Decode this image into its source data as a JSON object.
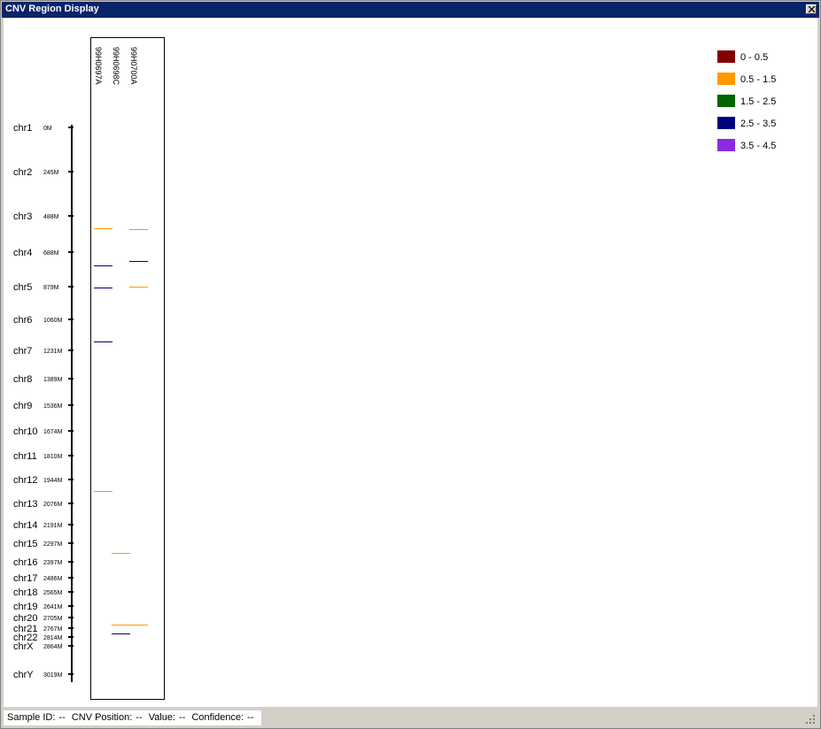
{
  "window": {
    "title": "CNV Region Display"
  },
  "samples": [
    "99H0697A",
    "99H0698C",
    "99H0700A"
  ],
  "chromosomes": [
    {
      "name": "chr1",
      "pos": "0M"
    },
    {
      "name": "chr2",
      "pos": "245M"
    },
    {
      "name": "chr3",
      "pos": "488M"
    },
    {
      "name": "chr4",
      "pos": "688M"
    },
    {
      "name": "chr5",
      "pos": "879M"
    },
    {
      "name": "chr6",
      "pos": "1060M"
    },
    {
      "name": "chr7",
      "pos": "1231M"
    },
    {
      "name": "chr8",
      "pos": "1389M"
    },
    {
      "name": "chr9",
      "pos": "1536M"
    },
    {
      "name": "chr10",
      "pos": "1674M"
    },
    {
      "name": "chr11",
      "pos": "1810M"
    },
    {
      "name": "chr12",
      "pos": "1944M"
    },
    {
      "name": "chr13",
      "pos": "2076M"
    },
    {
      "name": "chr14",
      "pos": "2191M"
    },
    {
      "name": "chr15",
      "pos": "2297M"
    },
    {
      "name": "chr16",
      "pos": "2397M"
    },
    {
      "name": "chr17",
      "pos": "2486M"
    },
    {
      "name": "chr18",
      "pos": "2565M"
    },
    {
      "name": "chr19",
      "pos": "2641M"
    },
    {
      "name": "chr20",
      "pos": "2705M"
    },
    {
      "name": "chr21",
      "pos": "2767M"
    },
    {
      "name": "chr22",
      "pos": "2814M"
    },
    {
      "name": "chrX",
      "pos": "2864M"
    },
    {
      "name": "chrY",
      "pos": "3019M"
    }
  ],
  "legend": [
    {
      "label": "0 - 0.5",
      "color": "#800000"
    },
    {
      "label": "0.5 - 1.5",
      "color": "#ff9900"
    },
    {
      "label": "1.5 - 2.5",
      "color": "#006400"
    },
    {
      "label": "2.5 - 3.5",
      "color": "#000080"
    },
    {
      "label": "3.5 - 4.5",
      "color": "#8a2be2"
    }
  ],
  "cnv_segments": [
    {
      "sample": 0,
      "position_mb": 555,
      "band": 1
    },
    {
      "sample": 2,
      "position_mb": 560,
      "band": 1
    },
    {
      "sample": 0,
      "position_mb": 763,
      "band": 3
    },
    {
      "sample": 2,
      "position_mb": 738,
      "band": 3
    },
    {
      "sample": 0,
      "position_mb": 883,
      "band": 3
    },
    {
      "sample": 2,
      "position_mb": 879,
      "band": 1
    },
    {
      "sample": 0,
      "position_mb": 1182,
      "band": 3
    },
    {
      "sample": 0,
      "position_mb": 2010,
      "band": 1
    },
    {
      "sample": 1,
      "position_mb": 2348,
      "band": 1
    },
    {
      "sample": 1,
      "position_mb": 2745,
      "band": 1,
      "extends_to_sample": 2
    },
    {
      "sample": 1,
      "position_mb": 2793,
      "band": 3
    }
  ],
  "status": {
    "sample_label": "Sample ID:",
    "sample_value": "--",
    "position_label": "CNV Position:",
    "position_value": "--",
    "value_label": "Value:",
    "value_value": "--",
    "confidence_label": "Confidence:",
    "confidence_value": "--"
  }
}
